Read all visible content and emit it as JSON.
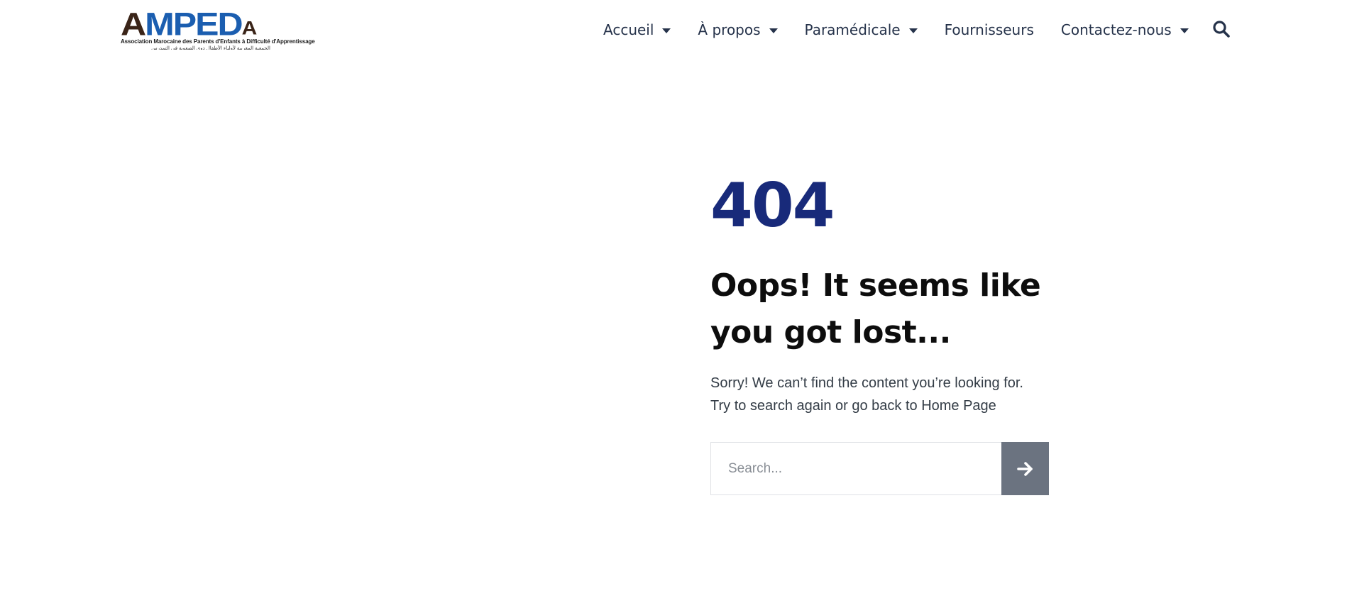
{
  "brand": {
    "logo_text": "AMPEDA",
    "logo_tagline": "Association Marocaine des Parents d'Enfants à Difficulté d'Apprentissage",
    "logo_tagline_ar": "الجمعية المغربية لأولياء الأطفال ذوي الصعوبة في التمدرس",
    "colors": {
      "blue": "#1b5eb0",
      "dark": "#3a2418"
    }
  },
  "nav": {
    "items": [
      {
        "label": "Accueil",
        "has_dropdown": true
      },
      {
        "label": "À propos",
        "has_dropdown": true
      },
      {
        "label": "Paramédicale",
        "has_dropdown": true
      },
      {
        "label": "Fournisseurs",
        "has_dropdown": false
      },
      {
        "label": "Contactez-nous",
        "has_dropdown": true
      }
    ],
    "search_icon": "search-icon"
  },
  "error_page": {
    "code": "404",
    "headline": "Oops! It seems like you got lost...",
    "message_line1": "Sorry! We can’t find the content you’re looking for.",
    "message_line2": "Try to search again or go back to Home Page",
    "accent_color": "#182a7a"
  },
  "search": {
    "placeholder": "Search...",
    "value": "",
    "submit_icon": "arrow-right-icon",
    "button_color": "#6b7380"
  }
}
